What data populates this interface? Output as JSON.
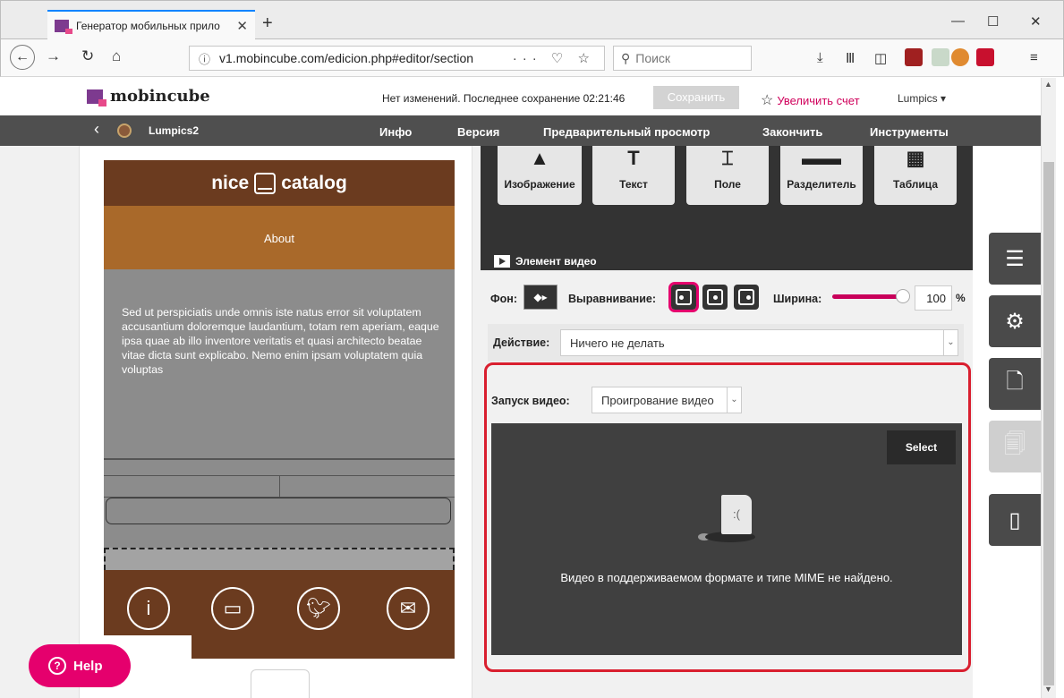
{
  "browser": {
    "tab_title": "Генератор мобильных прило",
    "tab_close": "✕",
    "new_tab": "+",
    "url": "v1.mobincube.com/edicion.php#editor/section",
    "url_info": "ⓘ",
    "url_actions": "··· ♡ ☆",
    "search_placeholder": "Поиск",
    "window_controls": {
      "minimize": "—",
      "maximize": "☐",
      "close": "✕"
    }
  },
  "app": {
    "logo_text": "mobincube",
    "save_status": "Нет изменений. Последнее сохранение 02:21:46",
    "save_button": "Сохранить",
    "upgrade": "Увеличить счет",
    "user": "Lumpics ▾",
    "project": "Lumpics2",
    "nav": [
      "Инфо",
      "Версия",
      "Предварительный просмотр",
      "Закончить",
      "Инструменты"
    ],
    "active_nav": "Версия"
  },
  "preview": {
    "header_left": "nice",
    "header_right": "catalog",
    "about": "About",
    "body_text": "Sed ut perspiciatis unde omnis iste natus error sit voluptatem accusantium doloremque laudantium, totam rem aperiam, eaque ipsa quae ab illo inventore veritatis et quasi architecto beatae vitae dicta sunt explicabo. Nemo enim ipsam voluptatem quia voluptas",
    "footer_icons": [
      "info-icon",
      "tablet-icon",
      "twitter-icon",
      "mail-icon"
    ],
    "help": "Help"
  },
  "palette": {
    "tiles": [
      "Изображение",
      "Текст",
      "Поле",
      "Разделитель",
      "Таблица"
    ]
  },
  "video_element": {
    "title": "Элемент видео",
    "bg_label": "Фон:",
    "align_label": "Выравнивание:",
    "width_label": "Ширина:",
    "width_value": "100",
    "width_unit": "%",
    "width_fraction": 1.0,
    "action_label": "Действие:",
    "action_value": "Ничего не делать",
    "start_label": "Запуск видео:",
    "start_value": "Проигрование видео",
    "select_button": "Select",
    "error_message": "Видео в поддерживаемом формате и типе MIME не найдено."
  },
  "colors": {
    "accent": "#e5006d",
    "brand_brown": "#6b3b1f",
    "about_bar": "#a9692a",
    "highlight_box": "#d91f2f",
    "nav_bg": "#4f4f4f"
  }
}
